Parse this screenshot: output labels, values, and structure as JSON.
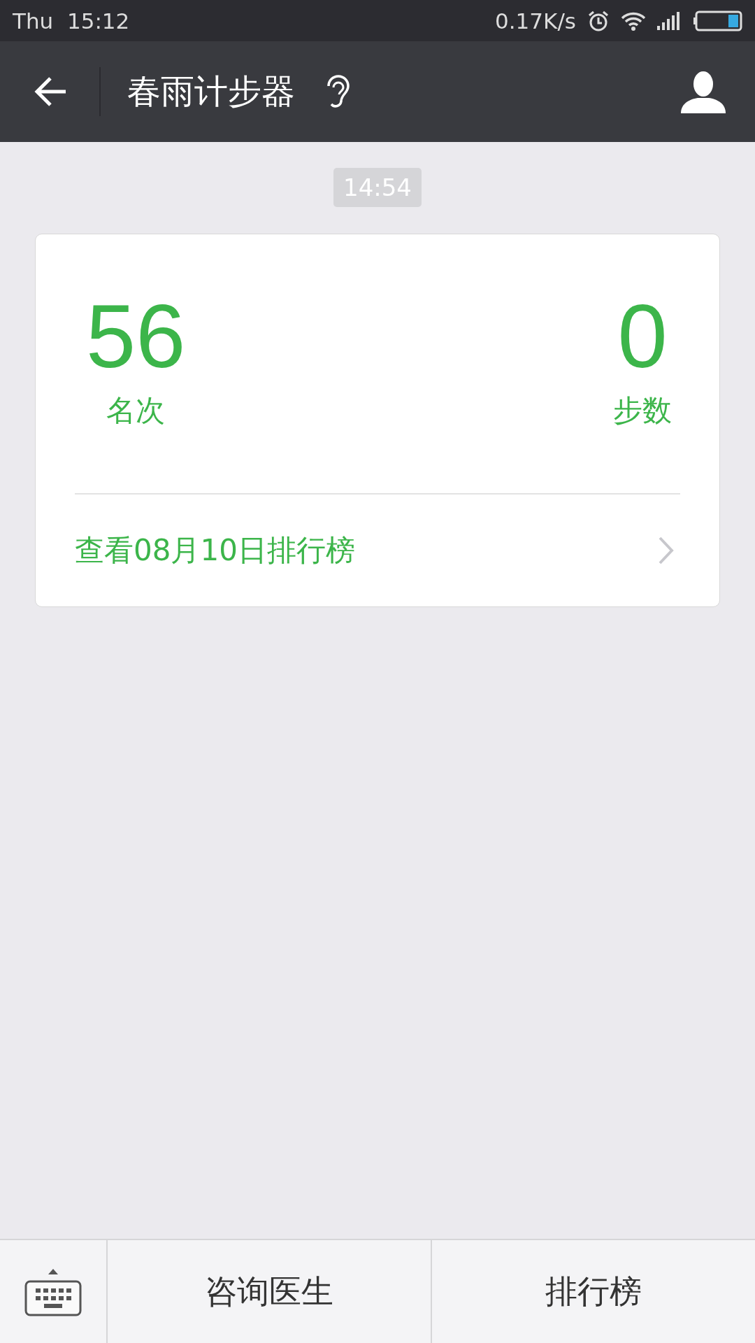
{
  "status_bar": {
    "day": "Thu",
    "time": "15:12",
    "speed": "0.17K/s"
  },
  "header": {
    "title": "春雨计步器"
  },
  "timestamp": "14:54",
  "card": {
    "stats": [
      {
        "value": "56",
        "label": "名次"
      },
      {
        "value": "0",
        "label": "步数"
      }
    ],
    "link": "查看08月10日排行榜"
  },
  "bottom_bar": {
    "buttons": [
      "咨询医生",
      "排行榜"
    ]
  }
}
